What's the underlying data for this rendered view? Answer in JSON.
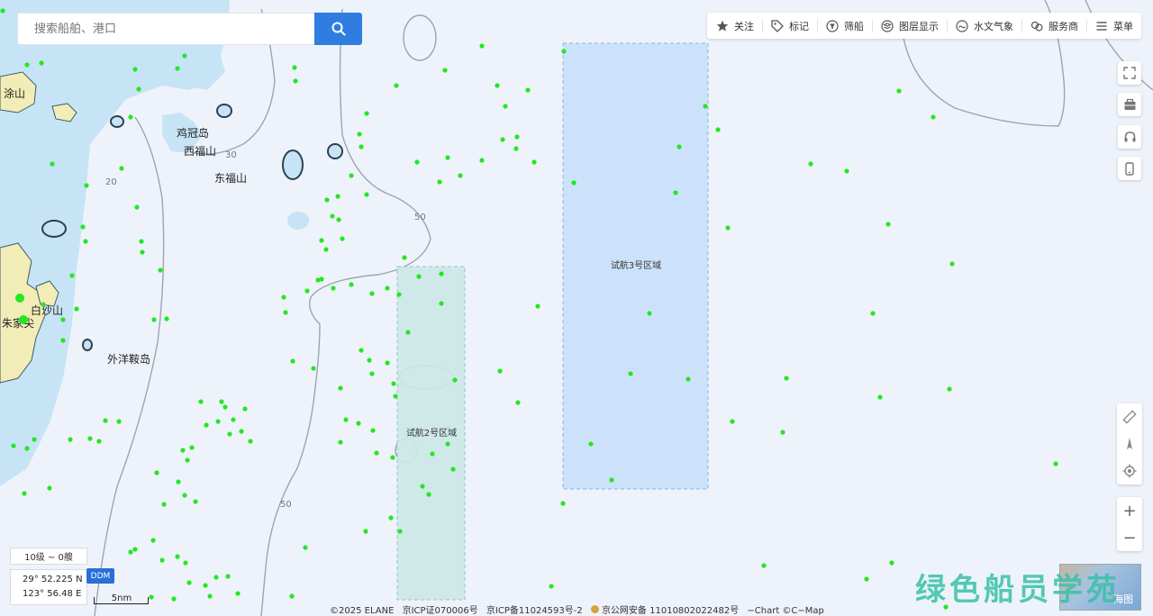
{
  "search": {
    "placeholder": "搜索船舶、港口"
  },
  "toolbar": [
    {
      "label": "关注",
      "icon": "star-icon"
    },
    {
      "label": "标记",
      "icon": "tag-icon"
    },
    {
      "label": "筛船",
      "icon": "filter-icon"
    },
    {
      "label": "图层显示",
      "icon": "layers-icon"
    },
    {
      "label": "水文气象",
      "icon": "weather-icon"
    },
    {
      "label": "服务商",
      "icon": "service-icon"
    },
    {
      "label": "菜单",
      "icon": "menu-icon"
    }
  ],
  "side_buttons": [
    "fullscreen-icon",
    "toolbox-icon",
    "headset-icon",
    "mobile-icon"
  ],
  "side_tools": [
    "ruler-icon",
    "compass-icon",
    "locate-icon"
  ],
  "zoom_buttons": {
    "plus": "+",
    "minus": "−"
  },
  "map": {
    "islands": [
      "涂山",
      "鸡冠岛",
      "西福山",
      "东福山",
      "外洋鞍岛",
      "白沙山",
      "朱家尖"
    ],
    "zones": [
      "试航3号区域",
      "试航2号区域"
    ],
    "depth_labels": [
      "30",
      "20",
      "50",
      "50"
    ],
    "colors": {
      "sea": "#eef3fb",
      "shallow": "#c6e4f5",
      "land": "#f2ecb6",
      "zone3": "#c9e1fb",
      "zone2": "#cce9e6",
      "ship": "#22e822"
    }
  },
  "status": {
    "zoom_level": "10级 ~ 0艘",
    "lat": "29° 52.225 N",
    "lon": "123° 56.48 E",
    "ddm_label": "DDM",
    "scale": "5nm"
  },
  "footer": {
    "copyright": "©2025 ELANE",
    "icp1": "京ICP证070006号",
    "icp2": "京ICP备11024593号-2",
    "police": "京公网安备 11010802022482号",
    "chart": "−Chart ©C−Map"
  },
  "watermark": "绿色船员学苑",
  "minimap_label": "海图"
}
